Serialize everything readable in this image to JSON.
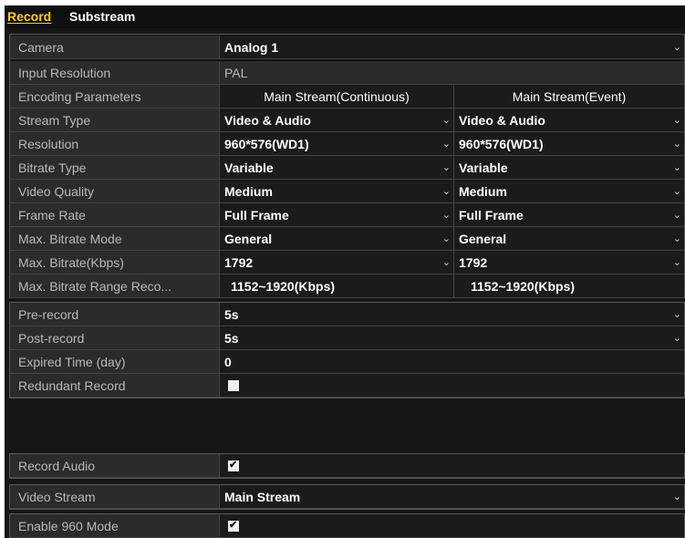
{
  "tabs": {
    "record": "Record",
    "substream": "Substream"
  },
  "icons": {
    "dropdown": "chevron-down-icon",
    "checkbox": "checkbox"
  },
  "fields": {
    "camera": {
      "label": "Camera",
      "value": "Analog 1"
    },
    "input_resolution": {
      "label": "Input Resolution",
      "value": "PAL"
    },
    "encoding_parameters": {
      "label": "Encoding Parameters",
      "main": "Main Stream(Continuous)",
      "event": "Main Stream(Event)"
    },
    "stream_type": {
      "label": "Stream Type",
      "main": "Video & Audio",
      "event": "Video & Audio"
    },
    "resolution": {
      "label": "Resolution",
      "main": "960*576(WD1)",
      "event": "960*576(WD1)"
    },
    "bitrate_type": {
      "label": "Bitrate Type",
      "main": "Variable",
      "event": "Variable"
    },
    "video_quality": {
      "label": "Video Quality",
      "main": "Medium",
      "event": "Medium"
    },
    "frame_rate": {
      "label": "Frame Rate",
      "main": "Full Frame",
      "event": "Full Frame"
    },
    "max_bitrate_mode": {
      "label": "Max. Bitrate Mode",
      "main": "General",
      "event": "General"
    },
    "max_bitrate": {
      "label": "Max. Bitrate(Kbps)",
      "main": "1792",
      "event": "1792"
    },
    "max_bitrate_range": {
      "label": "Max. Bitrate Range Reco...",
      "main": "1152~1920(Kbps)",
      "event": "1152~1920(Kbps)"
    },
    "pre_record": {
      "label": "Pre-record",
      "value": "5s"
    },
    "post_record": {
      "label": "Post-record",
      "value": "5s"
    },
    "expired_time": {
      "label": "Expired Time (day)",
      "value": "0"
    },
    "redundant_record": {
      "label": "Redundant Record",
      "checked": false
    },
    "record_audio": {
      "label": "Record Audio",
      "checked": true
    },
    "video_stream": {
      "label": "Video Stream",
      "value": "Main Stream"
    },
    "enable_960_mode": {
      "label": "Enable 960 Mode",
      "checked": true
    }
  }
}
